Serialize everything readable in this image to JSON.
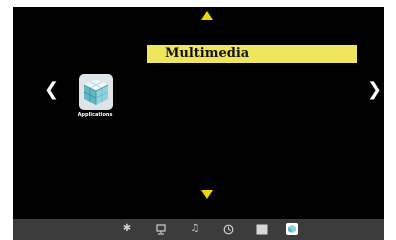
{
  "menu": {
    "title": "Multimedia",
    "items": [
      {
        "label": "Applications",
        "icon": "applications-cube-icon"
      }
    ]
  },
  "navigation": {
    "left_glyph": "❮",
    "right_glyph": "❯"
  },
  "bottom_bar": {
    "icons": [
      {
        "name": "settings-gear-icon",
        "glyph": "✱"
      },
      {
        "name": "monitor-icon",
        "glyph": ""
      },
      {
        "name": "music-note-icon",
        "glyph": "♫"
      },
      {
        "name": "clock-icon",
        "glyph": ""
      },
      {
        "name": "picture-icon",
        "glyph": ""
      },
      {
        "name": "applications-icon",
        "glyph": ""
      }
    ]
  },
  "colors": {
    "background": "#000000",
    "accent": "#efe65d",
    "arrow": "#e9d900",
    "bottom_bar": "#3c3c3c"
  }
}
